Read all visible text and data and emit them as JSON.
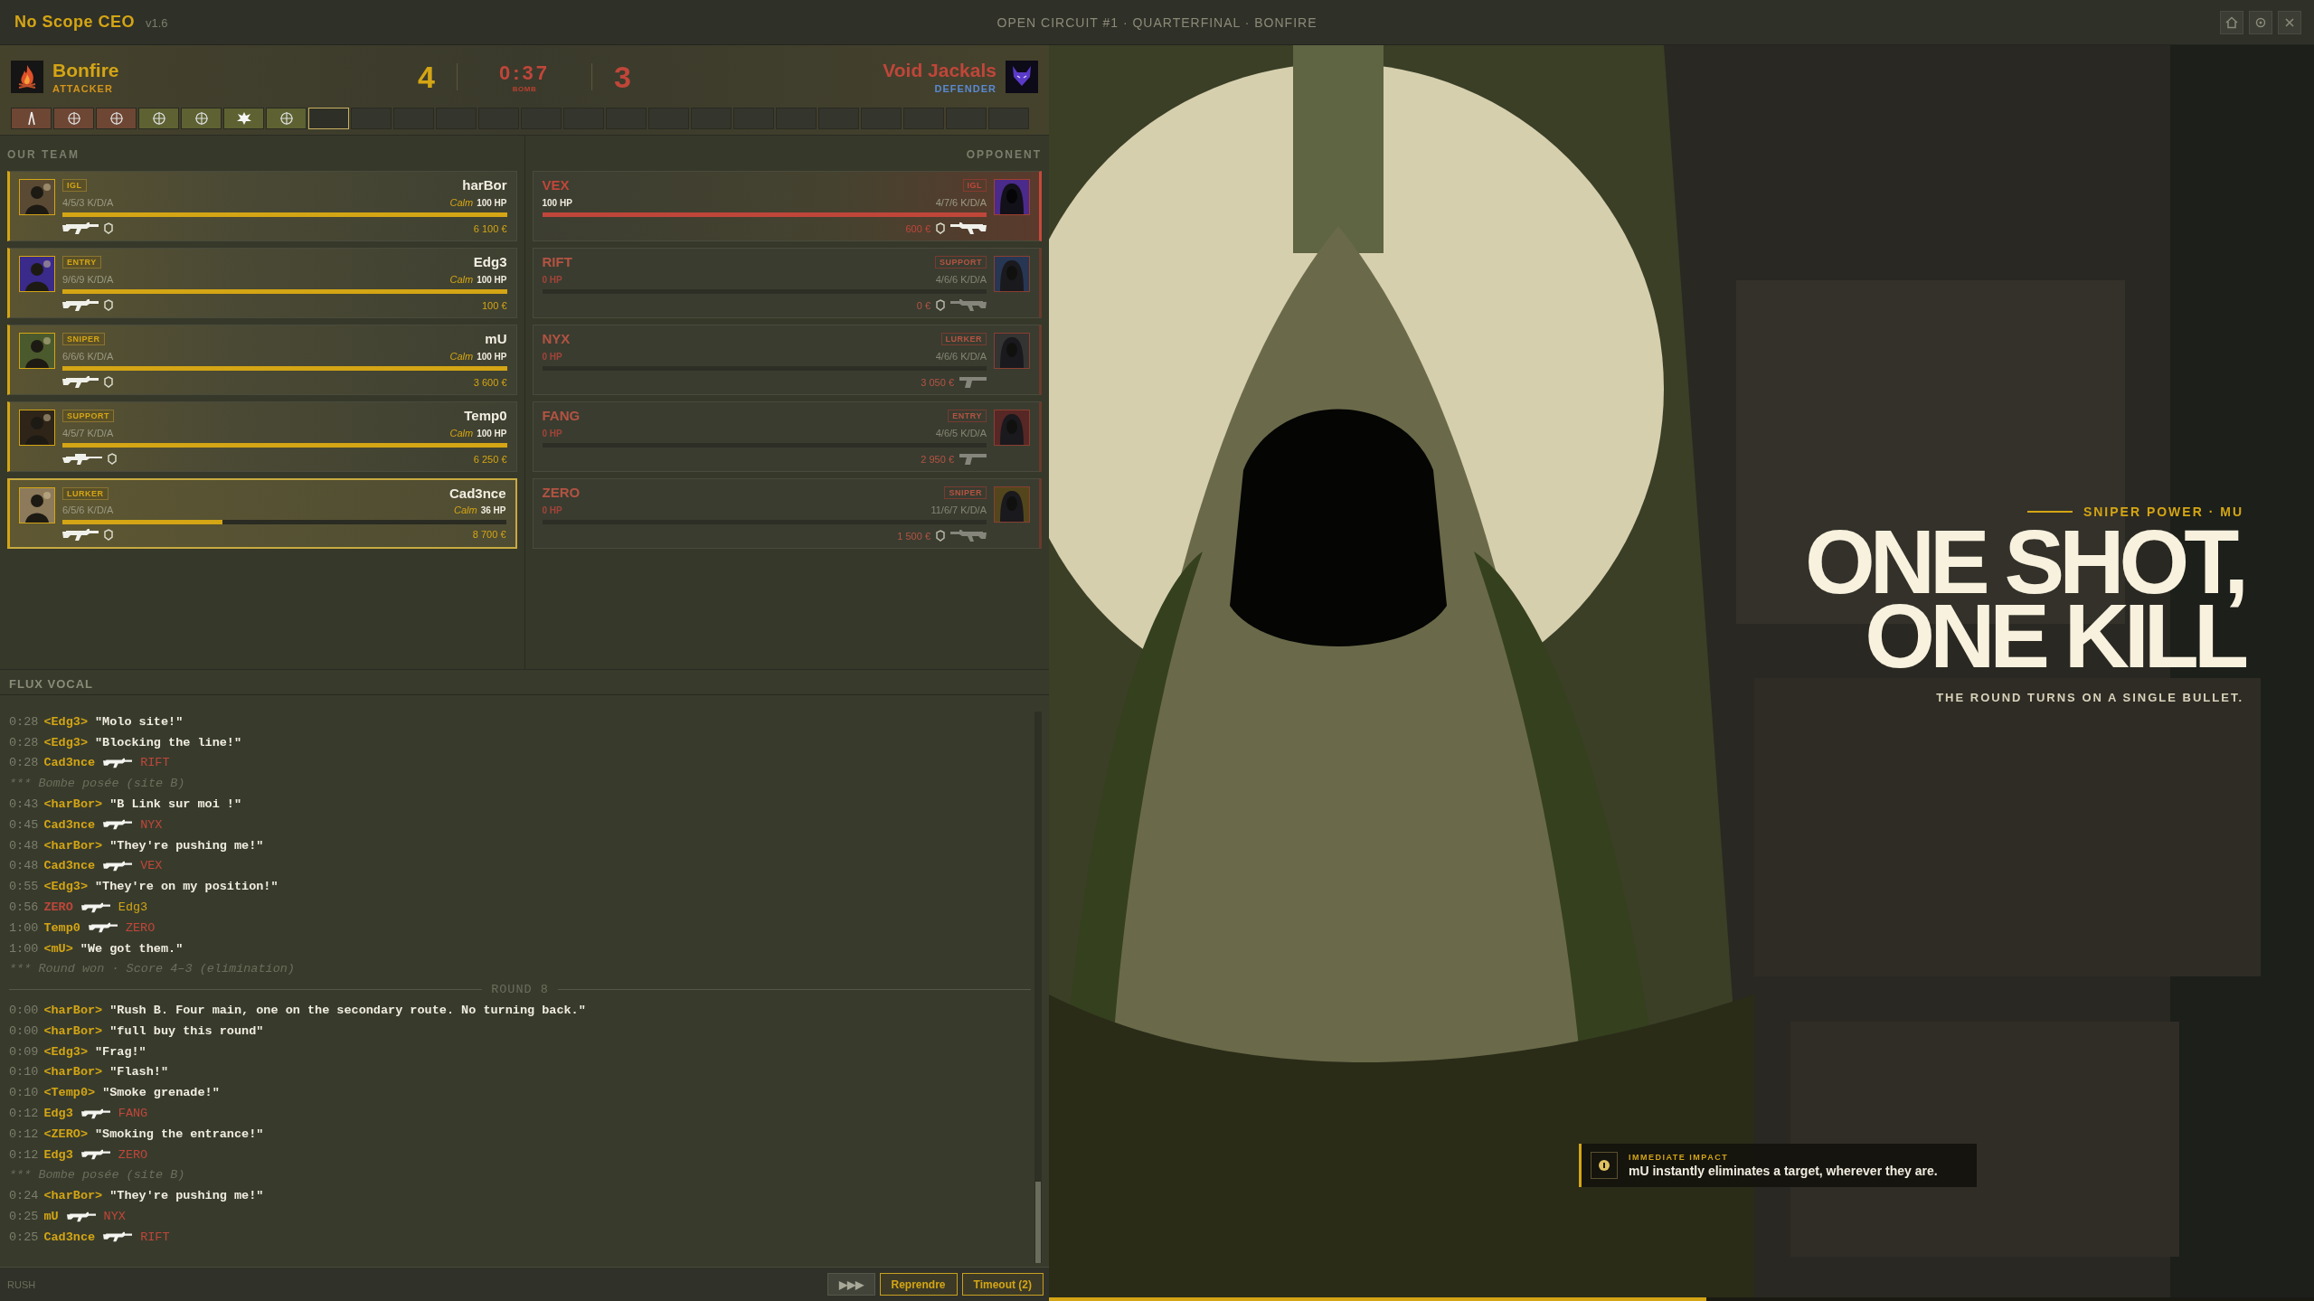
{
  "app": {
    "title": "No Scope CEO",
    "version": "v1.6",
    "match_title": "OPEN CIRCUIT #1 · QUARTERFINAL · BONFIRE"
  },
  "scoreboard": {
    "home": {
      "name": "Bonfire",
      "side": "ATTACKER",
      "score": "4"
    },
    "away": {
      "name": "Void Jackals",
      "side": "DEFENDER",
      "score": "3"
    },
    "timer": "0:37",
    "phase": "BOMB"
  },
  "rounds": [
    {
      "kind": "defuse",
      "played": true,
      "won": false,
      "current": false
    },
    {
      "kind": "elimination",
      "played": true,
      "won": false,
      "current": false
    },
    {
      "kind": "elimination",
      "played": true,
      "won": false,
      "current": false
    },
    {
      "kind": "elimination",
      "played": true,
      "won": true,
      "current": false
    },
    {
      "kind": "elimination",
      "played": true,
      "won": true,
      "current": false
    },
    {
      "kind": "explosion",
      "played": true,
      "won": true,
      "current": false
    },
    {
      "kind": "elimination",
      "played": true,
      "won": true,
      "current": false
    },
    {
      "played": false,
      "current": true
    },
    {
      "played": false,
      "current": false
    },
    {
      "played": false,
      "current": false
    },
    {
      "played": false,
      "current": false
    },
    {
      "played": false,
      "current": false
    },
    {
      "played": false,
      "current": false
    },
    {
      "played": false,
      "current": false
    },
    {
      "played": false,
      "current": false
    },
    {
      "played": false,
      "current": false
    },
    {
      "played": false,
      "current": false
    },
    {
      "played": false,
      "current": false
    },
    {
      "played": false,
      "current": false
    },
    {
      "played": false,
      "current": false
    },
    {
      "played": false,
      "current": false
    },
    {
      "played": false,
      "current": false
    },
    {
      "played": false,
      "current": false
    },
    {
      "played": false,
      "current": false
    }
  ],
  "our_team": {
    "heading": "OUR TEAM",
    "players": [
      {
        "name": "harBor",
        "role": "IGL",
        "kda": "4/5/3 K/D/A",
        "mood": "Calm",
        "hp": "100 HP",
        "level": 1,
        "kind": "rifle",
        "armor": true,
        "money": "6 100 €",
        "selected": false
      },
      {
        "name": "Edg3",
        "role": "ENTRY",
        "kda": "9/6/9 K/D/A",
        "mood": "Calm",
        "hp": "100 HP",
        "level": 1,
        "kind": "rifle",
        "armor": true,
        "money": "100 €",
        "selected": false
      },
      {
        "name": "mU",
        "role": "SNIPER",
        "kda": "6/6/6 K/D/A",
        "mood": "Calm",
        "hp": "100 HP",
        "level": 1,
        "kind": "rifle",
        "armor": true,
        "money": "3 600 €",
        "selected": false
      },
      {
        "name": "Temp0",
        "role": "SUPPORT",
        "kda": "4/5/7 K/D/A",
        "mood": "Calm",
        "hp": "100 HP",
        "level": 1,
        "kind": "sniper",
        "armor": true,
        "money": "6 250 €",
        "selected": false
      },
      {
        "name": "Cad3nce",
        "role": "LURKER",
        "kda": "6/5/6 K/D/A",
        "mood": "Calm",
        "hp": "36 HP",
        "level": 0.36,
        "kind": "rifle",
        "armor": true,
        "money": "8 700 €",
        "selected": true
      }
    ]
  },
  "opponent": {
    "heading": "OPPONENT",
    "players": [
      {
        "name": "VEX",
        "role": "IGL",
        "kda": "4/7/6 K/D/A",
        "hp": "100 HP",
        "level": 1,
        "kind": "rifle",
        "armor": true,
        "money": "600 €",
        "alive": true
      },
      {
        "name": "RIFT",
        "role": "SUPPORT",
        "kda": "4/6/6 K/D/A",
        "hp": "0 HP",
        "level": 0,
        "kind": "rifle",
        "armor": true,
        "money": "0 €",
        "alive": false
      },
      {
        "name": "NYX",
        "role": "LURKER",
        "kda": "4/6/6 K/D/A",
        "hp": "0 HP",
        "level": 0,
        "kind": "pistol",
        "armor": false,
        "money": "3 050 €",
        "alive": false
      },
      {
        "name": "FANG",
        "role": "ENTRY",
        "kda": "4/6/5 K/D/A",
        "hp": "0 HP",
        "level": 0,
        "kind": "pistol",
        "armor": false,
        "money": "2 950 €",
        "alive": false
      },
      {
        "name": "ZERO",
        "role": "SNIPER",
        "kda": "11/6/7 K/D/A",
        "hp": "0 HP",
        "level": 0,
        "kind": "rifle",
        "armor": true,
        "money": "1 500 €",
        "alive": false
      }
    ]
  },
  "feed": {
    "heading": "FLUX VOCAL",
    "lines": [
      {
        "kind": "say",
        "time": "0:28",
        "speaker": "<Edg3>",
        "text": "\"Molo site!\""
      },
      {
        "kind": "say",
        "time": "0:28",
        "speaker": "<Edg3>",
        "text": "\"Blocking the line!\""
      },
      {
        "kind": "kill",
        "time": "0:28",
        "killer": "Cad3nce",
        "victim": "RIFT",
        "killer_ours": true
      },
      {
        "kind": "event",
        "text": "*** Bombe posée (site B)"
      },
      {
        "kind": "say",
        "time": "0:43",
        "speaker": "<harBor>",
        "text": "\"B Link sur moi !\""
      },
      {
        "kind": "kill",
        "time": "0:45",
        "killer": "Cad3nce",
        "victim": "NYX",
        "killer_ours": true
      },
      {
        "kind": "say",
        "time": "0:48",
        "speaker": "<harBor>",
        "text": "\"They're pushing me!\""
      },
      {
        "kind": "kill",
        "time": "0:48",
        "killer": "Cad3nce",
        "victim": "VEX",
        "killer_ours": true
      },
      {
        "kind": "say",
        "time": "0:55",
        "speaker": "<Edg3>",
        "text": "\"They're on my position!\""
      },
      {
        "kind": "kill",
        "time": "0:56",
        "killer": "ZERO",
        "victim": "Edg3",
        "killer_ours": false
      },
      {
        "kind": "kill",
        "time": "1:00",
        "killer": "Temp0",
        "victim": "ZERO",
        "killer_ours": true
      },
      {
        "kind": "say",
        "time": "1:00",
        "speaker": "<mU>",
        "text": "\"We got them.\""
      },
      {
        "kind": "event",
        "text": "*** Round won · Score 4–3 (elimination)"
      },
      {
        "kind": "divider",
        "text": "ROUND 8"
      },
      {
        "kind": "say",
        "time": "0:00",
        "speaker": "<harBor>",
        "text": "\"Rush B. Four main, one on the secondary route. No turning back.\""
      },
      {
        "kind": "say",
        "time": "0:00",
        "speaker": "<harBor>",
        "text": "\"full buy this round\""
      },
      {
        "kind": "say",
        "time": "0:09",
        "speaker": "<Edg3>",
        "text": "\"Frag!\""
      },
      {
        "kind": "say",
        "time": "0:10",
        "speaker": "<harBor>",
        "text": "\"Flash!\""
      },
      {
        "kind": "say",
        "time": "0:10",
        "speaker": "<Temp0>",
        "text": "\"Smoke grenade!\""
      },
      {
        "kind": "kill",
        "time": "0:12",
        "killer": "Edg3",
        "victim": "FANG",
        "killer_ours": true
      },
      {
        "kind": "say",
        "time": "0:12",
        "speaker": "<ZERO>",
        "text": "\"Smoking the entrance!\""
      },
      {
        "kind": "kill",
        "time": "0:12",
        "killer": "Edg3",
        "victim": "ZERO",
        "killer_ours": true
      },
      {
        "kind": "event",
        "text": "*** Bombe posée (site B)"
      },
      {
        "kind": "say",
        "time": "0:24",
        "speaker": "<harBor>",
        "text": "\"They're pushing me!\""
      },
      {
        "kind": "kill",
        "time": "0:25",
        "killer": "mU",
        "victim": "NYX",
        "killer_ours": true
      },
      {
        "kind": "kill",
        "time": "0:25",
        "killer": "Cad3nce",
        "victim": "RIFT",
        "killer_ours": true
      }
    ]
  },
  "footer": {
    "tactic": "RUSH",
    "buttons": [
      "▶▶▶",
      "Reprendre",
      "Timeout (2)"
    ]
  },
  "power": {
    "eyebrow": "SNIPER POWER · MU",
    "headline": "ONE SHOT, ONE KILL",
    "tagline": "THE ROUND TURNS ON A SINGLE BULLET.",
    "impact_label": "IMMEDIATE IMPACT",
    "impact_text": "mU instantly eliminates a target, wherever they are.",
    "level": 0.52
  }
}
